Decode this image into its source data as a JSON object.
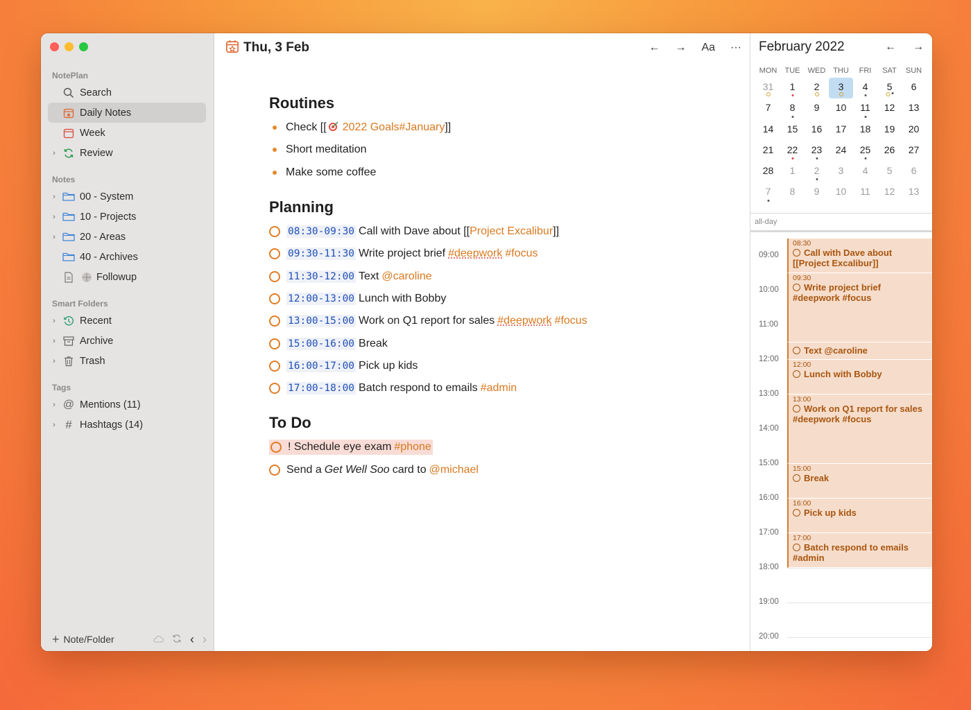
{
  "sidebar": {
    "app_section": "NotePlan",
    "app_items": [
      {
        "label": "Search",
        "icon": "search-icon"
      },
      {
        "label": "Daily Notes",
        "icon": "calendar-star-icon",
        "selected": true
      },
      {
        "label": "Week",
        "icon": "calendar-icon"
      },
      {
        "label": "Review",
        "icon": "refresh-icon"
      }
    ],
    "notes_section": "Notes",
    "notes_items": [
      {
        "label": "00 - System",
        "icon": "folder-icon"
      },
      {
        "label": "10 - Projects",
        "icon": "folder-icon"
      },
      {
        "label": "20 - Areas",
        "icon": "folder-icon"
      },
      {
        "label": "40 - Archives",
        "icon": "folder-icon"
      },
      {
        "label": "Followup",
        "icon": "document-icon"
      }
    ],
    "smart_section": "Smart Folders",
    "smart_items": [
      {
        "label": "Recent",
        "icon": "clock-icon"
      },
      {
        "label": "Archive",
        "icon": "archive-box-icon"
      },
      {
        "label": "Trash",
        "icon": "trash-icon"
      }
    ],
    "tags_section": "Tags",
    "tags_items": [
      {
        "label": "Mentions (11)",
        "icon": "at-icon"
      },
      {
        "label": "Hashtags (14)",
        "icon": "hash-icon"
      }
    ],
    "new_note_label": "Note/Folder"
  },
  "editor": {
    "title": "Thu, 3 Feb",
    "font_button": "Aa",
    "more_button": "···",
    "routines_heading": "Routines",
    "routines": {
      "r1_prefix": "Check [[",
      "r1_link": "2022 Goals#January",
      "r1_suffix": "]]",
      "r2": "Short meditation",
      "r3": "Make some coffee"
    },
    "planning_heading": "Planning",
    "planning": [
      {
        "time": "08:30-09:30",
        "text": "Call with Dave about [[",
        "link": "Project Excalibur",
        "suffix": "]]"
      },
      {
        "time": "09:30-11:30",
        "text": "Write project brief",
        "tag1": "#deepwork",
        "tag2": "#focus"
      },
      {
        "time": "11:30-12:00",
        "text": "Text",
        "tag1": "@caroline"
      },
      {
        "time": "12:00-13:00",
        "text": "Lunch with Bobby"
      },
      {
        "time": "13:00-15:00",
        "text": "Work on Q1 report for sales",
        "tag1": "#deepwork",
        "tag2": "#focus"
      },
      {
        "time": "15:00-16:00",
        "text": "Break"
      },
      {
        "time": "16:00-17:00",
        "text": "Pick up kids"
      },
      {
        "time": "17:00-18:00",
        "text": "Batch respond to emails",
        "tag1": "#admin"
      }
    ],
    "todo_heading": "To Do",
    "todo": {
      "t1_text": "! Schedule eye exam",
      "t1_tag": "#phone",
      "t2_pre": "Send a",
      "t2_em": "Get Well Soo",
      "t2_mid": "card to",
      "t2_tag": "@michael"
    }
  },
  "calendar": {
    "month": "February 2022",
    "weekdays": [
      "MON",
      "TUE",
      "WED",
      "THU",
      "FRI",
      "SAT",
      "SUN"
    ],
    "weeks": [
      [
        "31",
        "1",
        "2",
        "3",
        "4",
        "5",
        "6"
      ],
      [
        "7",
        "8",
        "9",
        "10",
        "11",
        "12",
        "13"
      ],
      [
        "14",
        "15",
        "16",
        "17",
        "18",
        "19",
        "20"
      ],
      [
        "21",
        "22",
        "23",
        "24",
        "25",
        "26",
        "27"
      ],
      [
        "28",
        "1",
        "2",
        "3",
        "4",
        "5",
        "6"
      ],
      [
        "7",
        "8",
        "9",
        "10",
        "11",
        "12",
        "13"
      ]
    ],
    "allday_label": "all-day",
    "hours": [
      "09:00",
      "10:00",
      "11:00",
      "12:00",
      "13:00",
      "14:00",
      "15:00",
      "16:00",
      "17:00",
      "18:00",
      "19:00",
      "20:00"
    ],
    "events": [
      {
        "time": "08:30",
        "title": "Call with Dave about [[Project Excalibur]]"
      },
      {
        "time": "09:30",
        "title": "Write project brief #deepwork #focus"
      },
      {
        "time": "",
        "title": "Text @caroline"
      },
      {
        "time": "12:00",
        "title": "Lunch with Bobby"
      },
      {
        "time": "13:00",
        "title": "Work on Q1 report for sales #deepwork #focus"
      },
      {
        "time": "15:00",
        "title": "Break"
      },
      {
        "time": "16:00",
        "title": "Pick up kids"
      },
      {
        "time": "17:00",
        "title": "Batch respond to emails #admin"
      }
    ]
  },
  "colors": {
    "accent": "#d9791f",
    "time_blue": "#2050b8",
    "event_bg": "#f6ddcb",
    "today_bg": "#c2dcf2"
  }
}
